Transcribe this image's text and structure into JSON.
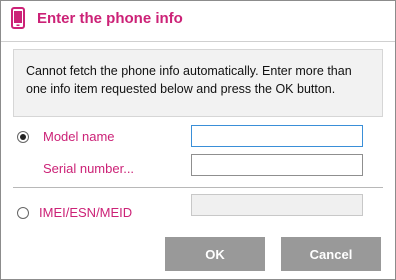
{
  "window": {
    "title": "Enter the phone info",
    "icon": "mobile-phone-icon",
    "accent_color": "#cc2277"
  },
  "info": {
    "message": "Cannot fetch the phone info automatically. Enter more than one info item requested below and press the OK button."
  },
  "options": {
    "model_radio_selected": true,
    "model_label": "Model name",
    "model_value": "",
    "serial_label": "Serial number...",
    "serial_value": "",
    "imei_radio_selected": false,
    "imei_label": "IMEI/ESN/MEID",
    "imei_value": ""
  },
  "buttons": {
    "ok_label": "OK",
    "cancel_label": "Cancel"
  }
}
